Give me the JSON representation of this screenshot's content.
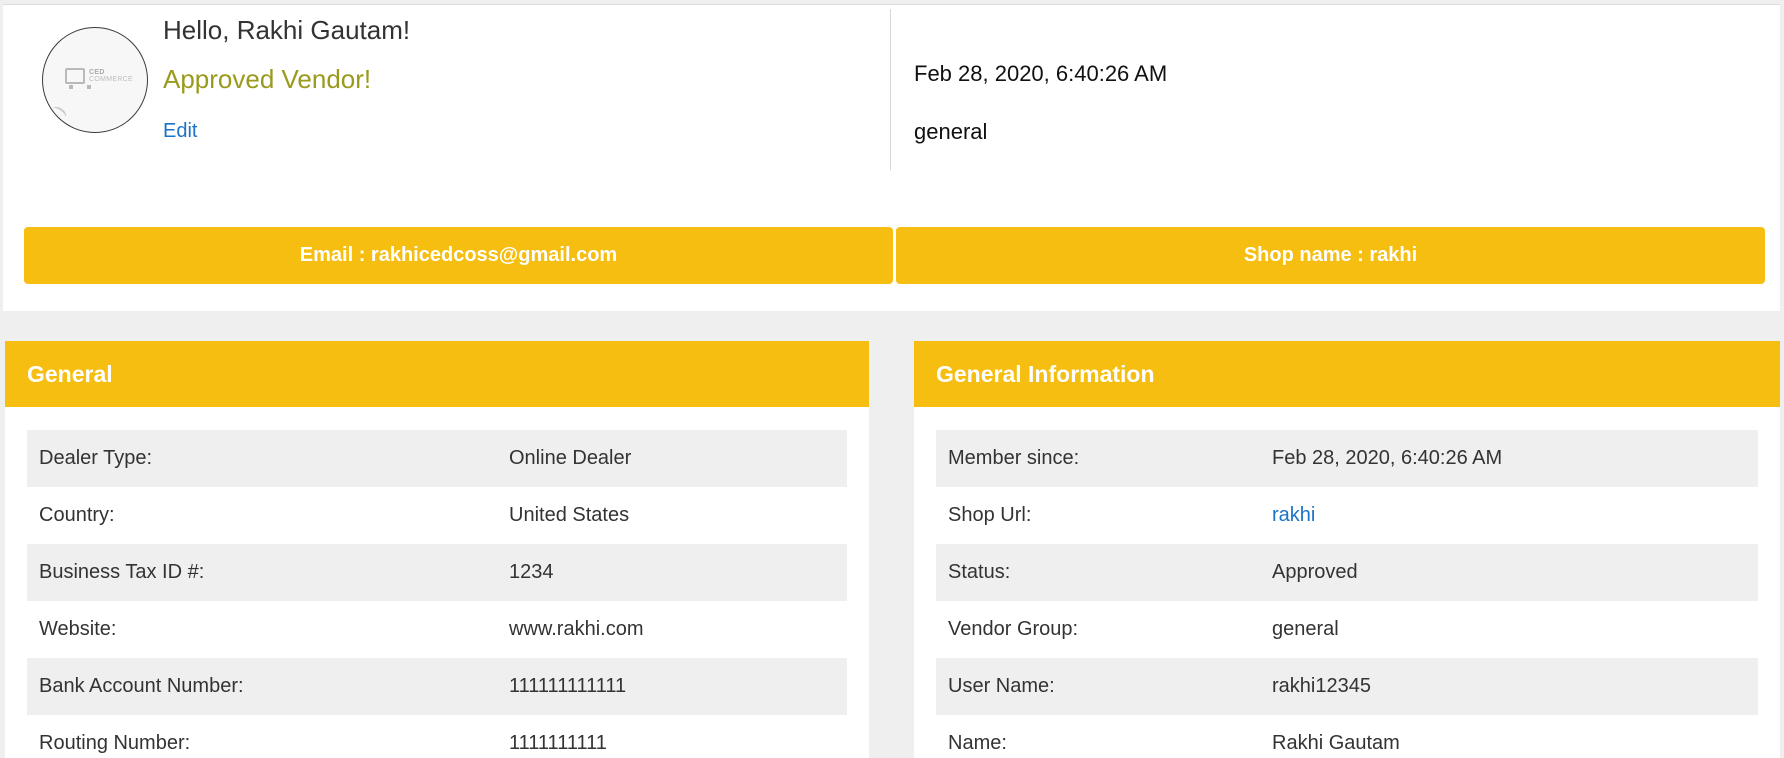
{
  "profile": {
    "greeting": "Hello, Rakhi Gautam!",
    "status": "Approved Vendor!",
    "edit_label": "Edit",
    "avatar_logo": {
      "top": "CED",
      "bottom": "COMMERCE"
    },
    "joined_date": "Feb 28, 2020, 6:40:26 AM",
    "group": "general",
    "email_bar": "Email : rakhicedcoss@gmail.com",
    "shop_bar": "Shop name : rakhi"
  },
  "colors": {
    "accent": "#f5be10",
    "status": "#9a9a1c",
    "link": "#1a73c8"
  },
  "general_panel": {
    "title": "General",
    "rows": [
      {
        "label": "Dealer Type:",
        "value": "Online Dealer"
      },
      {
        "label": "Country:",
        "value": "United States"
      },
      {
        "label": "Business Tax ID #:",
        "value": "1234"
      },
      {
        "label": "Website:",
        "value": "www.rakhi.com"
      },
      {
        "label": "Bank Account Number:",
        "value": "111111111111"
      },
      {
        "label": "Routing Number:",
        "value": "1111111111"
      }
    ]
  },
  "info_panel": {
    "title": "General Information",
    "rows": [
      {
        "label": "Member since:",
        "value": "Feb 28, 2020, 6:40:26 AM"
      },
      {
        "label": "Shop Url:",
        "value": "rakhi"
      },
      {
        "label": "Status:",
        "value": "Approved"
      },
      {
        "label": "Vendor Group:",
        "value": "general"
      },
      {
        "label": "User Name:",
        "value": "rakhi12345"
      },
      {
        "label": "Name:",
        "value": "Rakhi Gautam"
      }
    ]
  }
}
